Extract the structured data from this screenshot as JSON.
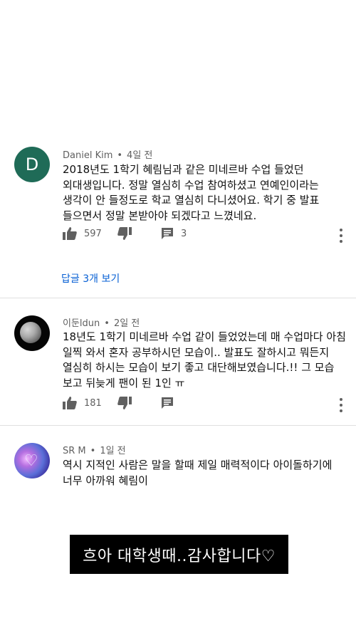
{
  "comments": [
    {
      "author": "Daniel Kim",
      "time": "4일 전",
      "avatar_letter": "D",
      "text": "2018년도 1학기 혜림님과 같은 미네르바 수업 들었던 외대생입니다. 정말 열심히 수업 참여하셨고 연예인이라는 생각이 안 들정도로 학교 열심히 다니셨어요. 학기 중 발표 들으면서 정말 본받아야 되겠다고 느꼈네요.",
      "likes": "597",
      "replies_count": "3",
      "view_replies": "답글 3개 보기"
    },
    {
      "author": "이둔ldun",
      "time": "2일 전",
      "text": "18년도 1학기 미네르바 수업 같이 들었었는데 매 수업마다 아침 일찍 와서 혼자 공부하시던 모습이.. 발표도 잘하시고 뭐든지 열심히 하시는 모습이 보기 좋고 대단해보였습니다.!! 그 모습 보고 뒤늦게 팬이 된 1인 ㅠ",
      "likes": "181"
    },
    {
      "author": "SR M",
      "time": "1일 전",
      "text": "역시 지적인 사람은 말을 할때 제일 매력적이다 아이돌하기에 너무 아까워 혜림이"
    }
  ],
  "banner": "흐아 대학생때..감사합니다♡",
  "icons": {
    "like": "thumbs-up-icon",
    "dislike": "thumbs-down-icon",
    "reply": "comment-icon",
    "more": "more-vertical-icon"
  },
  "colors": {
    "link": "#065fd4",
    "meta": "#606060",
    "avatar_d": "#1f6b57"
  },
  "separator": "•"
}
